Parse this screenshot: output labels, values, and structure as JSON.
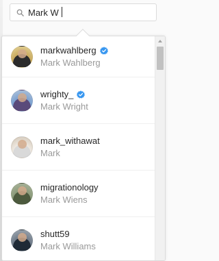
{
  "search": {
    "value": "Mark W",
    "icon": "search-icon"
  },
  "results": [
    {
      "username": "markwahlberg",
      "full_name": "Mark Wahlberg",
      "verified": true
    },
    {
      "username": "wrighty_",
      "full_name": "Mark Wright",
      "verified": true
    },
    {
      "username": "mark_withawat",
      "full_name": "Mark",
      "verified": false
    },
    {
      "username": "migrationology",
      "full_name": "Mark Wiens",
      "verified": false
    },
    {
      "username": "shutt59",
      "full_name": "Mark Williams",
      "verified": false
    }
  ],
  "colors": {
    "verified_badge": "#3897f0",
    "username_text": "#262626",
    "fullname_text": "#999999",
    "border": "#dbdbdb"
  }
}
